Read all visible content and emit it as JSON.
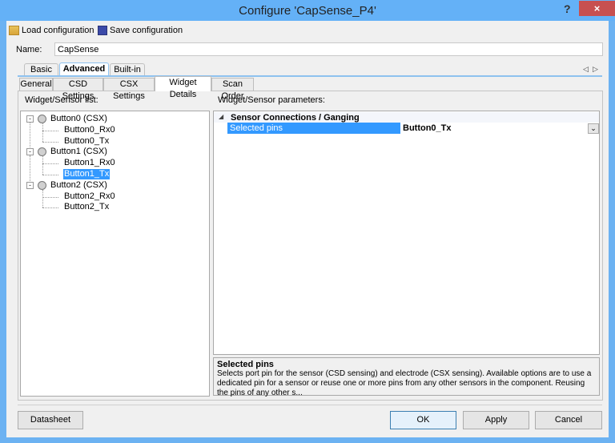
{
  "window": {
    "title": "Configure 'CapSense_P4'",
    "help": "?",
    "close": "×"
  },
  "toolbar": {
    "load": "Load configuration",
    "save": "Save configuration"
  },
  "name": {
    "label": "Name:",
    "value": "CapSense"
  },
  "outer_tabs": [
    {
      "label": "Basic"
    },
    {
      "label": "Advanced"
    },
    {
      "label": "Built-in"
    }
  ],
  "inner_tabs": [
    {
      "label": "General"
    },
    {
      "label": "CSD Settings"
    },
    {
      "label": "CSX Settings"
    },
    {
      "label": "Widget Details"
    },
    {
      "label": "Scan Order"
    }
  ],
  "left": {
    "label": "Widget/Sensor list:"
  },
  "tree": [
    {
      "label": "Button0 (CSX)",
      "children": [
        "Button0_Rx0",
        "Button0_Tx"
      ]
    },
    {
      "label": "Button1 (CSX)",
      "children": [
        "Button1_Rx0",
        "Button1_Tx"
      ]
    },
    {
      "label": "Button2 (CSX)",
      "children": [
        "Button2_Rx0",
        "Button2_Tx"
      ]
    }
  ],
  "selected_node": "Button1_Tx",
  "right": {
    "label": "Widget/Sensor parameters:",
    "category": "Sensor Connections / Ganging",
    "property": {
      "name": "Selected pins",
      "value": "Button0_Tx"
    },
    "description": {
      "title": "Selected pins",
      "text": "Selects port pin for the sensor (CSD sensing) and electrode (CSX sensing). Available options are to use a dedicated pin for a sensor or reuse one or more pins from any other sensors in the component. Reusing the pins of any other s..."
    }
  },
  "buttons": {
    "datasheet": "Datasheet",
    "ok": "OK",
    "apply": "Apply",
    "cancel": "Cancel"
  },
  "colors": {
    "accent": "#3399ff",
    "titlebar": "#64b1f7",
    "close": "#c75050"
  }
}
